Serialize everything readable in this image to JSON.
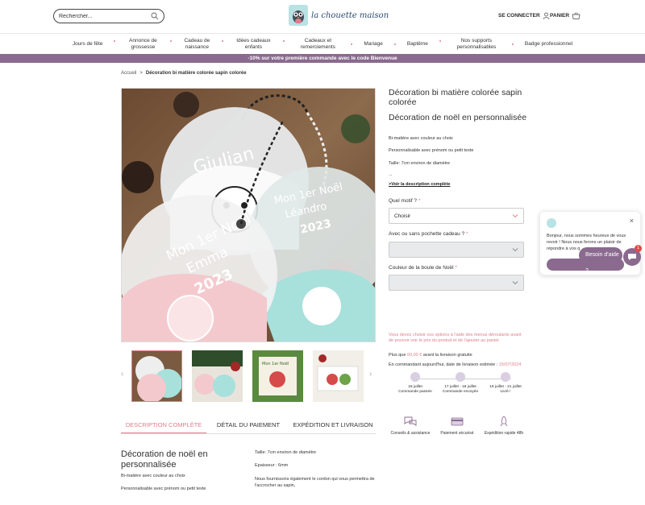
{
  "header": {
    "search_placeholder": "Rechercher...",
    "logo_text": "la chouette maison",
    "account_label": "SE CONNECTER",
    "cart_label": "PANIER"
  },
  "nav": {
    "items": [
      "Jours de fête",
      "Annonce de grossesse",
      "Cadeau de naissance",
      "Idées cadeaux enfants",
      "Cadeaux et remerciements",
      "Mariage",
      "Baptême",
      "Nos supports personnalisables",
      "Badge professionnel"
    ]
  },
  "promo": "-10% sur votre première commande avec le code Bienvenue",
  "breadcrumb": {
    "home": "Accueil",
    "sep": ">",
    "current": "Décoration bi matière colorée sapin colorée"
  },
  "product": {
    "title": "Décoration bi matière colorée sapin colorée",
    "subtitle": "Décoration de noël en personnalisée",
    "line1": "Bi-matière avec couleur au choix",
    "line2": "Personnalisable avec prénom ou petit texte",
    "line3": "Taille: 7cm environ de diamètre",
    "ellipsis": "...",
    "see_more": ">Voir la description complète",
    "motif_label": "Quel motif ?",
    "motif_value": "Choisir",
    "pochette_label": "Avec ou sans pochette cadeau ?",
    "couleur_label": "Couleur de la boule de Noël",
    "required_mark": "*",
    "warning": "Vous devez choisir vos options à l'aide des menus déroulants avant de pouvoir voir le prix du produit et de l'ajouter au panier",
    "free_ship_prefix": "Plus que",
    "free_ship_amount": "60,00 €",
    "free_ship_suffix": "avant la livraison gratuite",
    "delivery_prefix": "En commandant aujourd'hui, date de livraison estimée :",
    "delivery_date": "15/07/2024"
  },
  "steps": [
    {
      "date": "16 juillet",
      "label": "Commande passée"
    },
    {
      "date": "17 juillet - 18 juillet",
      "label": "Commande envoyée"
    },
    {
      "date": "19 juillet - 21 juillet",
      "label": "Livré !"
    }
  ],
  "features": [
    {
      "label": "Conseils & assistance",
      "icon": "chat-bubbles-icon"
    },
    {
      "label": "Paiement sécurisé",
      "icon": "card-icon"
    },
    {
      "label": "Expédition rapide 48h",
      "icon": "rocket-icon"
    }
  ],
  "gallery": {
    "main_texts": [
      "Giulian",
      "Mon 1er Noël",
      "Léandro",
      "2023",
      "Mon 1er Noël",
      "Emma",
      "2023"
    ],
    "thumb_text": "Mon 1er Noël"
  },
  "tabs": [
    "DESCRIPTION COMPLÈTE",
    "DÉTAIL DU PAIEMENT",
    "EXPÉDITION ET LIVRAISON"
  ],
  "description": {
    "title": "Décoration de noël en personnalisée",
    "left1": "Bi-matière avec couleur au choix",
    "left2": "Personnalisable avec prénom ou petit texte",
    "right1": "Taille: 7cm environ de diamètre",
    "right2": "Epaisseur : 6mm",
    "right3": "Nous fournissons également le cordon qui vous permettra de l'accrocher au sapin,"
  },
  "chat": {
    "message": "Bonjour, nous sommes heureux de vous revoir ! Nous nous ferons un plaisir de répondre à vos q",
    "help_label": "Besoin d'aide ?",
    "badge": "1",
    "close": "×"
  },
  "colors": {
    "accent": "#e07d8b",
    "brand": "#8a6a8e",
    "mint": "#a8e0dc",
    "pink": "#f4c9cd"
  }
}
